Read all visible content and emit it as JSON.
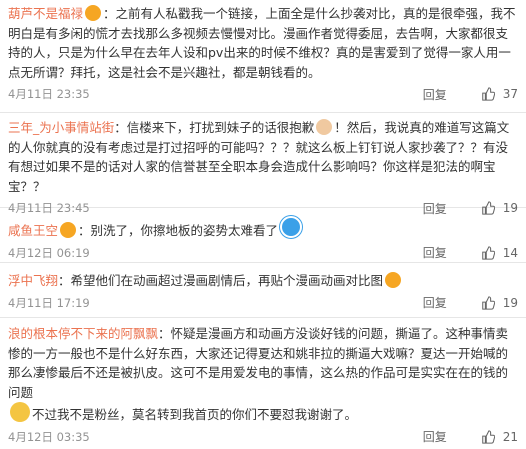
{
  "comments": [
    {
      "user": "葫芦不是福禄",
      "sep": "：",
      "text": "之前有人私戳我一个链接，上面全是什么抄袭对比，真的是很牵强，我不明白是有多闲的慌才去找那么多视频去慢慢对比。漫画作者觉得委屈，去告啊，大家都很支持的人，只是为什么早在去年人设和pv出来的时候不维权？真的是害爱到了觉得一家人用一点无所谓？拜托，这是社会不是兴趣社，都是朝钱看的。",
      "time": "4月11日 23:35",
      "reply": "回复",
      "likes": "37"
    },
    {
      "user": "三年_为小事情站街",
      "sep": "：",
      "text_a": "信楼来下，打扰到妹子的话很抱歉",
      "text_b": "！然后，我说真的难道写这篇文的人你就真的没有考虑过是打过招呼的可能吗？？？就这么板上钉钉说人家抄袭了？？有没有想过如果不是的话对人家的信誉甚至全职本身会造成什么影响吗？你这样是犯法的啊宝宝？？",
      "time": "4月11日 23:45",
      "reply": "回复",
      "likes": "19"
    },
    {
      "user": "咸鱼王空",
      "sep": "：",
      "text": "别洗了，你擦地板的姿势太难看了",
      "time": "4月12日 06:19",
      "reply": "回复",
      "likes": "14"
    },
    {
      "user": "浮中飞翔",
      "sep": "：",
      "text": "希望他们在动画超过漫画剧情后，再贴个漫画动画对比图",
      "time": "4月11日 17:19",
      "reply": "回复",
      "likes": "19"
    },
    {
      "user": "浪的根本停不下来的阿飘飘",
      "sep": "：",
      "text_a": "怀疑是漫画方和动画方没谈好钱的问题，撕逼了。这种事情卖惨的一方一般也不是什么好东西，大家还记得夏达和姚非拉的撕逼大戏嘛？夏达一开始喊的那么凄惨最后不还是被扒皮。这可不是用爱发电的事情，这么热的作品可是实实在在的钱的问题",
      "text_b": "不过我不是粉丝，莫名转到我首页的你们不要怼我谢谢了。",
      "time": "4月12日 03:35",
      "reply": "回复",
      "likes": "21"
    }
  ],
  "colors": {
    "username": "#eb7350",
    "meta": "#939393",
    "divider": "#e6e6e6"
  }
}
